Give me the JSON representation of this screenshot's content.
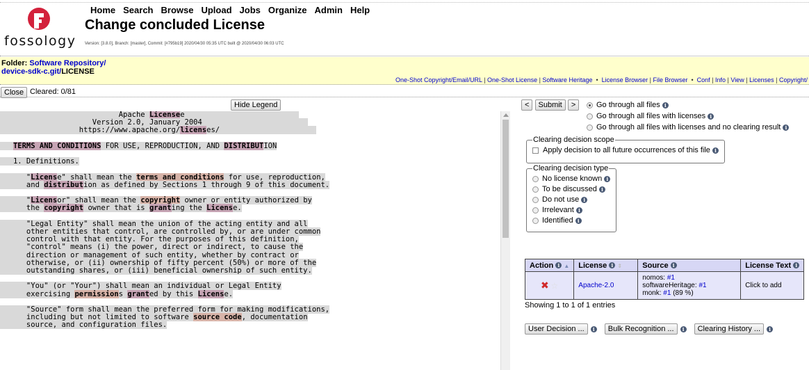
{
  "brand": {
    "logo_text": "fossology"
  },
  "menu": [
    "Home",
    "Search",
    "Browse",
    "Upload",
    "Jobs",
    "Organize",
    "Admin",
    "Help"
  ],
  "page_title": "Change concluded License",
  "version_line": "Version: [3.8.0], Branch: [master], Commit: [#795b19] 2020/04/30 05:35 UTC built @ 2020/04/30 06:03 UTC",
  "folder": {
    "label": "Folder",
    "path1": "Software Repository/",
    "path2_link": "device-sdk-c.git/",
    "path2_file": "LICENSE"
  },
  "linkbar": {
    "items": [
      "One-Shot Copyright/Email/URL",
      "One-Shot License",
      "Software Heritage",
      "License Browser",
      "File Browser",
      "Conf",
      "Info",
      "View",
      "Licenses",
      "Copyright/"
    ]
  },
  "closebar": {
    "close_label": "Close",
    "cleared": "Cleared: 0/81"
  },
  "legend_button": "Hide Legend",
  "license_text": {
    "header": [
      "Apache ",
      "License",
      "",
      "Version 2.0, January 2004",
      "https://www.apache.org/",
      "licens",
      "es/"
    ],
    "terms_line": [
      "TERMS AND CONDITIONS",
      " FOR USE, REPRODUCTION, AND ",
      "DISTRIBUT",
      "ION"
    ],
    "definitions": "1. Definitions."
  },
  "navigation": {
    "prev": "<",
    "submit": "Submit",
    "next": ">",
    "options": [
      "Go through all files",
      "Go through all files with licenses",
      "Go through all files with licenses and no clearing result"
    ]
  },
  "scope": {
    "legend": "Clearing decision scope",
    "checkbox": "Apply decision to all future occurrences of this file"
  },
  "decision_type": {
    "legend": "Clearing decision type",
    "options": [
      "No license known",
      "To be discussed",
      "Do not use",
      "Irrelevant",
      "Identified"
    ]
  },
  "license_table": {
    "headers": [
      "Action",
      "License",
      "Source",
      "License Text"
    ],
    "row": {
      "license": "Apache-2.0",
      "source_lines": [
        {
          "prefix": "nomos: ",
          "link": "#1",
          "suffix": ""
        },
        {
          "prefix": "softwareHeritage: ",
          "link": "#1",
          "suffix": ""
        },
        {
          "prefix": "monk: ",
          "link": "#1",
          "suffix": " (89 %)"
        }
      ],
      "license_text": "Click to add"
    },
    "showing": "Showing 1 to 1 of 1 entries"
  },
  "bottom_buttons": [
    "User Decision ...",
    "Bulk Recognition ...",
    "Clearing History ..."
  ],
  "colors": {
    "folder_bar": "#ffffcc",
    "table_header": "#d7d7f5",
    "table_row": "#e6e6fa",
    "link": "#0000cc",
    "keyword_highlight": "#c6a4b4"
  }
}
